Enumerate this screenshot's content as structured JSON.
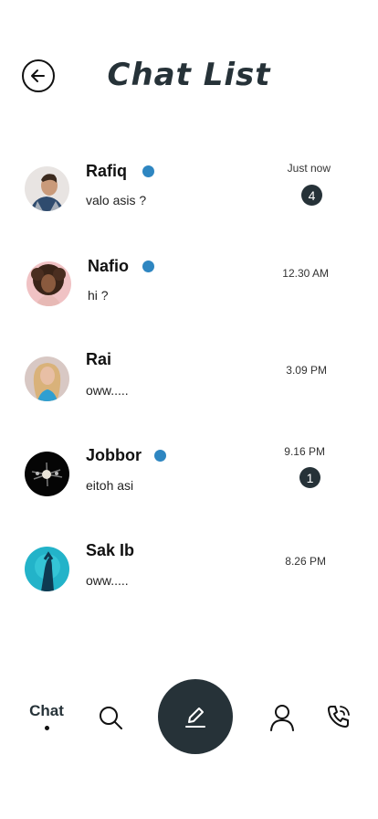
{
  "header": {
    "title": "Chat List",
    "back_icon": "arrow-left-circle-icon"
  },
  "chats": [
    {
      "name": "Rafiq",
      "message": "valo asis ?",
      "time": "Just now",
      "online": true,
      "unread": "4"
    },
    {
      "name": "Nafio",
      "message": "hi ?",
      "time": "12.30 AM",
      "online": true,
      "unread": ""
    },
    {
      "name": "Rai",
      "message": "oww.....",
      "time": "3.09 PM",
      "online": false,
      "unread": ""
    },
    {
      "name": "Jobbor",
      "message": "eitoh asi",
      "time": "9.16 PM",
      "online": true,
      "unread": "1"
    },
    {
      "name": "Sak Ib",
      "message": "oww.....",
      "time": "8.26 PM",
      "online": false,
      "unread": ""
    }
  ],
  "bottom_nav": {
    "chat_label": "Chat",
    "search_icon": "search-icon",
    "compose_icon": "pencil-icon",
    "profile_icon": "user-icon",
    "call_icon": "phone-call-icon"
  },
  "colors": {
    "primary": "#263238",
    "online": "#2e86c1"
  }
}
